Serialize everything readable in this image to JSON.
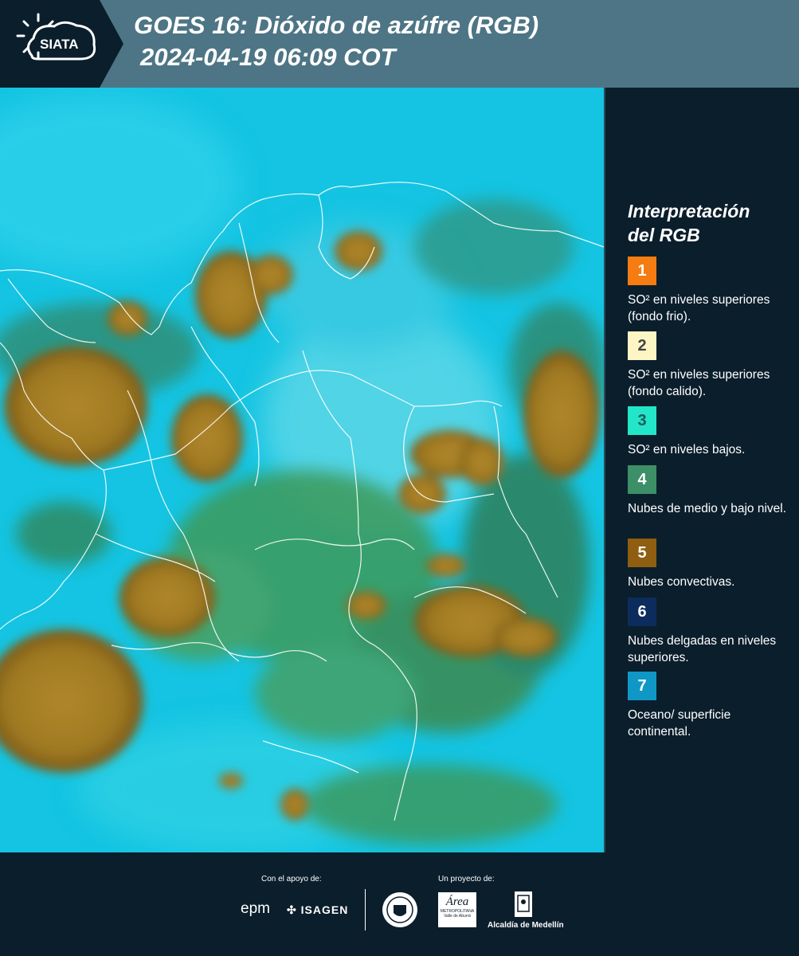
{
  "header": {
    "logo_text": "SIATA",
    "title_line1": "GOES 16: Dióxido de azúfre (RGB)",
    "title_line2": "2024-04-19 06:09 COT"
  },
  "legend": {
    "title_line1": "Interpretación",
    "title_line2": "del RGB",
    "items": [
      {
        "number": "1",
        "color": "#f47c10",
        "text_color": "#ffffff",
        "label": "SO² en niveles superiores (fondo frio)."
      },
      {
        "number": "2",
        "color": "#fdf6c4",
        "text_color": "#444444",
        "label": "SO² en niveles superiores (fondo calido)."
      },
      {
        "number": "3",
        "color": "#22e6c8",
        "text_color": "#1a5a5a",
        "label": "SO² en niveles bajos."
      },
      {
        "number": "4",
        "color": "#3c8f66",
        "text_color": "#ffffff",
        "label": "Nubes de medio y bajo nivel."
      },
      {
        "number": "5",
        "color": "#8f5e10",
        "text_color": "#ffffff",
        "label": "Nubes convectivas."
      },
      {
        "number": "6",
        "color": "#0c2c5e",
        "text_color": "#ffffff",
        "label": "Nubes delgadas en niveles superiores."
      },
      {
        "number": "7",
        "color": "#0f98c6",
        "text_color": "#ffffff",
        "label": "Oceano/ superficie continental."
      }
    ]
  },
  "footer": {
    "support_label": "Con el apoyo de:",
    "project_label": "Un proyecto de:",
    "sponsor_epm": "epm",
    "sponsor_isagen": "ISAGEN",
    "area_text": "Área",
    "area_sub1": "METROPOLITANA",
    "area_sub2": "Valle de Aburrá",
    "alcaldia": "Alcaldía de Medellín"
  }
}
